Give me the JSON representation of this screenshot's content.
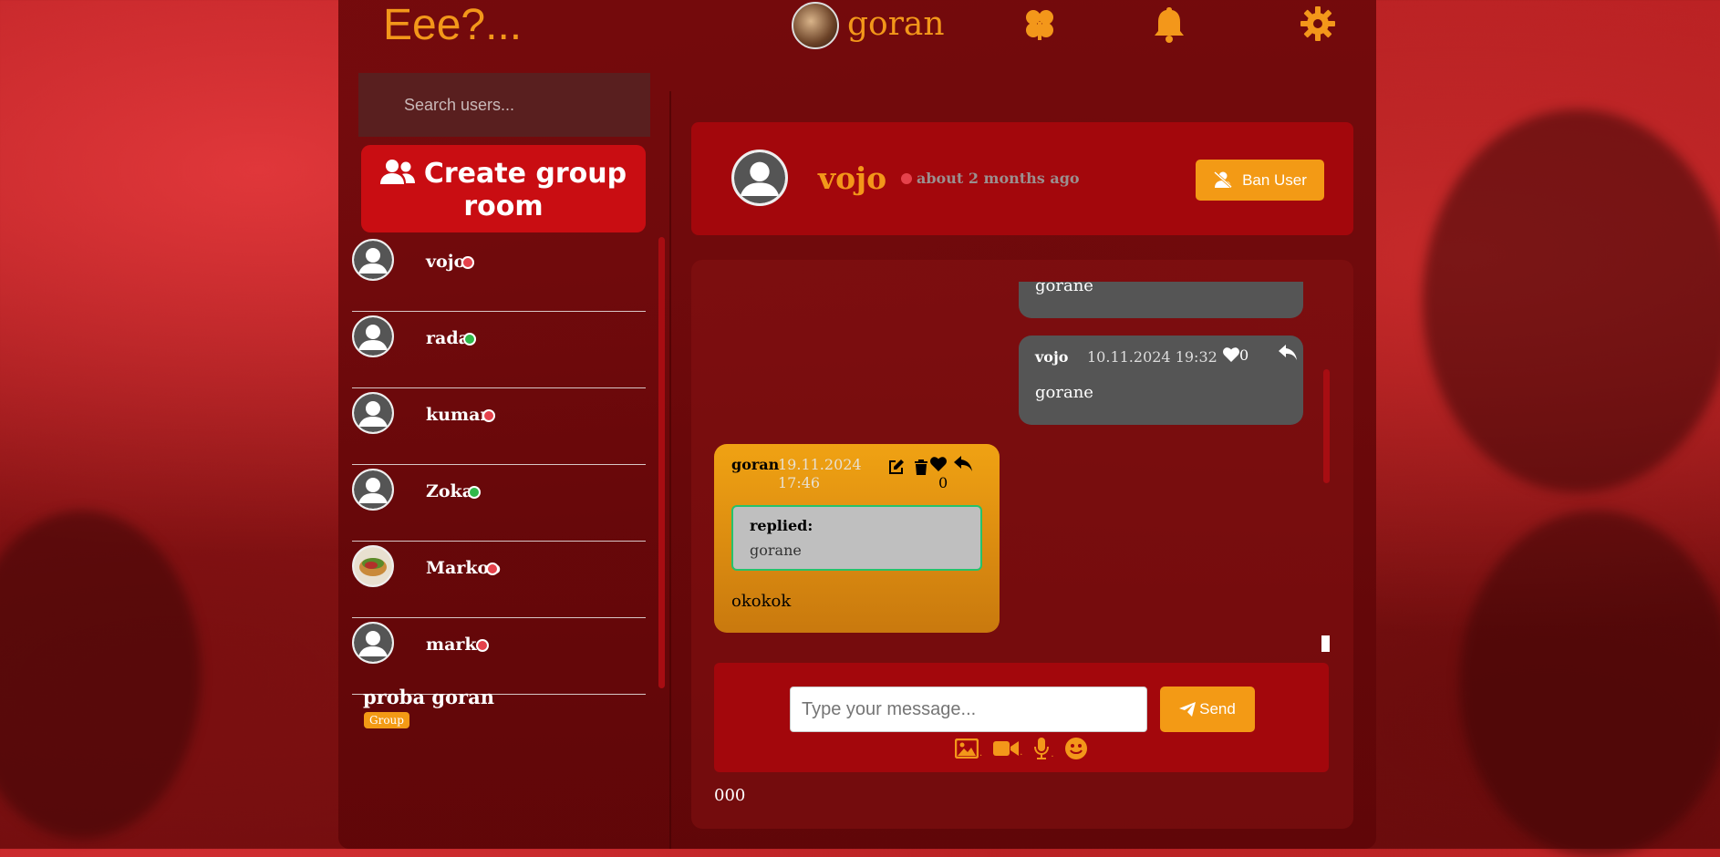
{
  "app": {
    "brand": "Eee?...",
    "current_user": "goran"
  },
  "sidebar": {
    "search_placeholder": "Search users...",
    "create_group_label": "Create group room",
    "users": [
      {
        "name": "vojo",
        "online": false
      },
      {
        "name": "rada",
        "online": true
      },
      {
        "name": "kuman",
        "online": false
      },
      {
        "name": "Zoka",
        "online": true
      },
      {
        "name": "Markoo",
        "online": false
      },
      {
        "name": "marko",
        "online": false
      }
    ],
    "group": {
      "name": "proba goran",
      "badge": "Group"
    }
  },
  "chat": {
    "header": {
      "name": "vojo",
      "status": "about 2 months ago",
      "ban_label": "Ban User"
    },
    "messages": [
      {
        "text": "gorane"
      },
      {
        "author": "vojo",
        "date": "10.11.2024 19:32",
        "likes": "0",
        "text": "gorane"
      },
      {
        "author": "goran",
        "date": "19.11.2024 17:46",
        "likes": "0",
        "reply_label": "replied:",
        "reply_text": "gorane",
        "text": "okokok"
      }
    ],
    "composer": {
      "placeholder": "Type your message...",
      "send_label": "Send"
    },
    "counter": "000"
  },
  "colors": {
    "accent": "#f3971a",
    "header_red": "#a3070c",
    "online": "#2fb94a",
    "offline": "#e5414b"
  }
}
